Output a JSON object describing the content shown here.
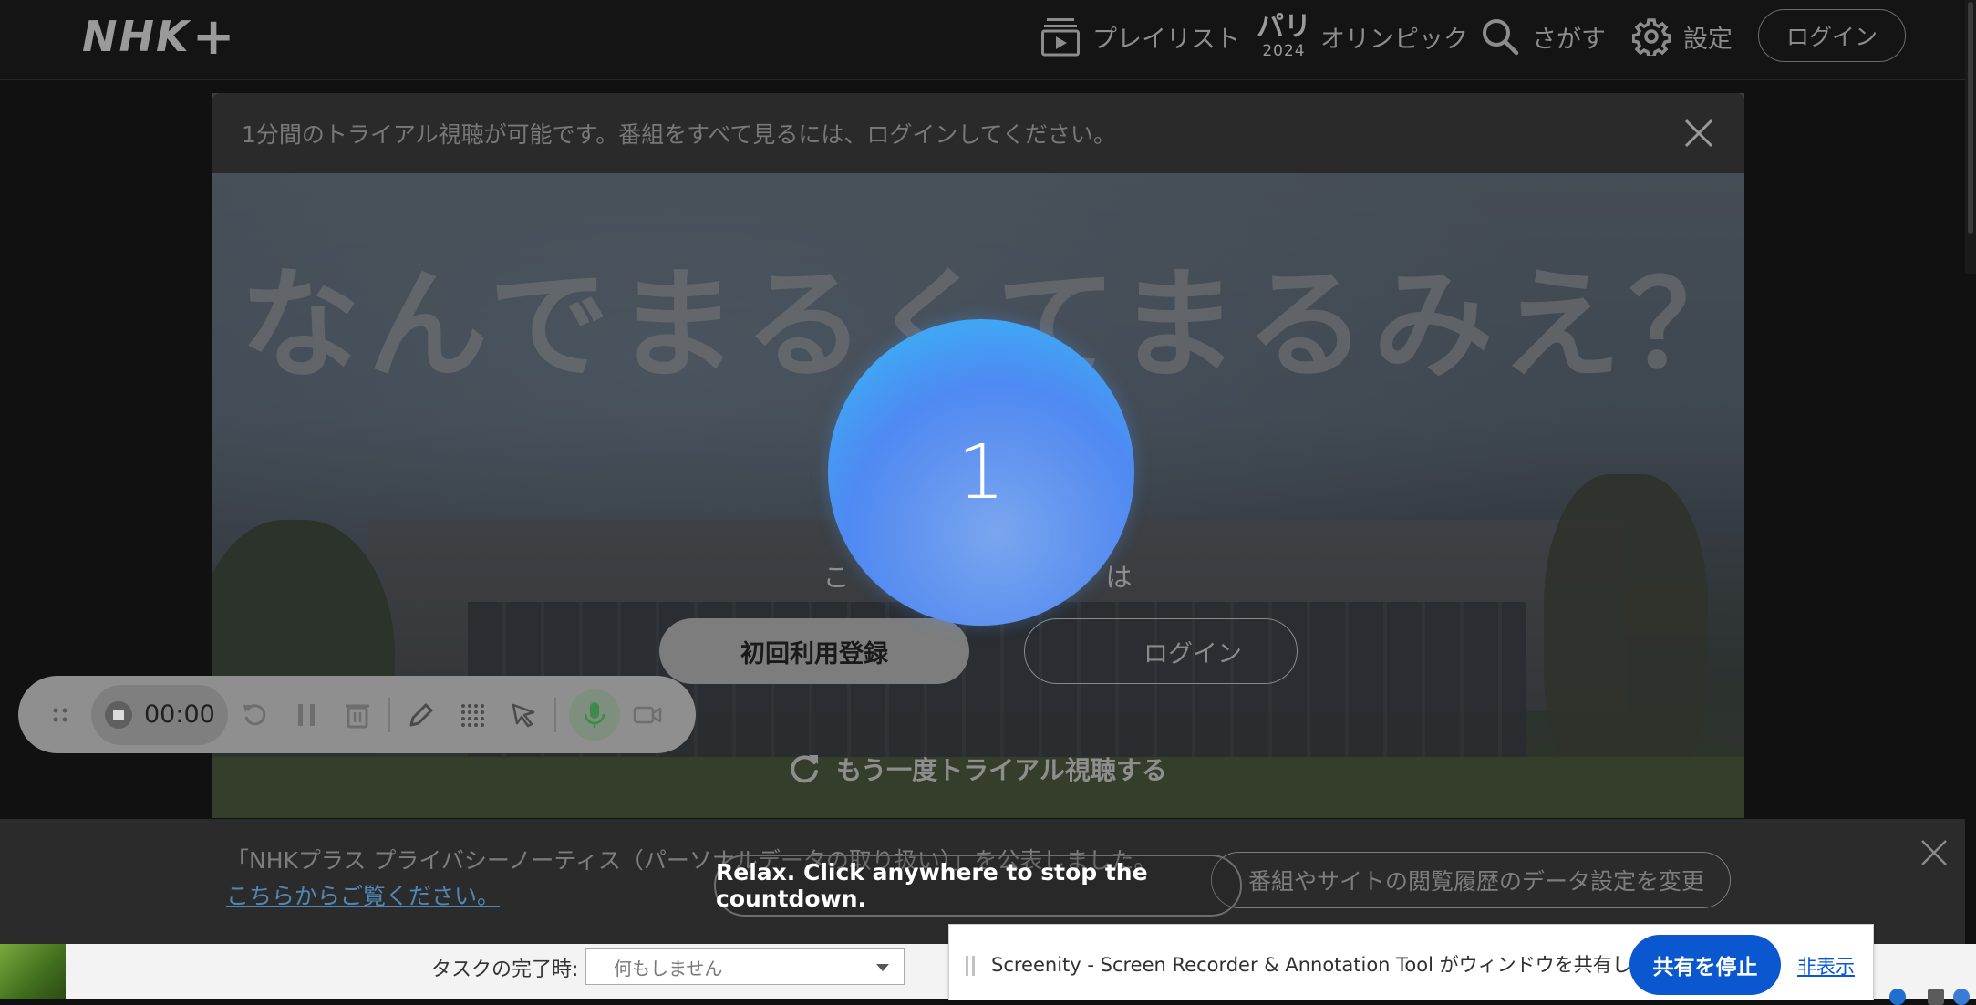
{
  "header": {
    "logo": "NHK",
    "logo_plus": "+",
    "nav": {
      "playlist": "プレイリスト",
      "olympic_mark_top": "パリ",
      "olympic_mark_year": "2024",
      "olympic": "オリンピック",
      "search": "さがす",
      "settings": "設定"
    },
    "login": "ログイン"
  },
  "player": {
    "trial_banner": "1分間のトライアル視聴が可能です。番組をすべて見るには、ログインしてください。",
    "program_title": "なんでまるくてまるみえ？",
    "signup_prompt": "こ　　　　　　　　　は",
    "signup_button": "初回利用登録",
    "login_button": "ログイン",
    "retry_trial": "もう一度トライアル視聴する"
  },
  "countdown": {
    "value": "1",
    "hint": "Relax. Click anywhere to stop the countdown."
  },
  "recorder": {
    "time": "00:00"
  },
  "privacy": {
    "text": "「NHKプラス プライバシーノーティス（パーソナルデータの取り扱い）」を公表しました。",
    "link": "こちらからご覧ください。",
    "settings_button": "番組やサイトの閲覧履歴のデータ設定を変更"
  },
  "background_window": {
    "task_label": "タスクの完了時:",
    "task_select_value": "何もしません"
  },
  "share_bar": {
    "text": "Screenity - Screen Recorder & Annotation Tool がウィンドウを共有しています。",
    "stop_button": "共有を停止",
    "hide_link": "非表示"
  },
  "colors": {
    "page_bg": "#111111",
    "countdown_blue": "#4e8af2",
    "share_stop_blue": "#0b57d0",
    "link_blue": "#4f86b3"
  }
}
